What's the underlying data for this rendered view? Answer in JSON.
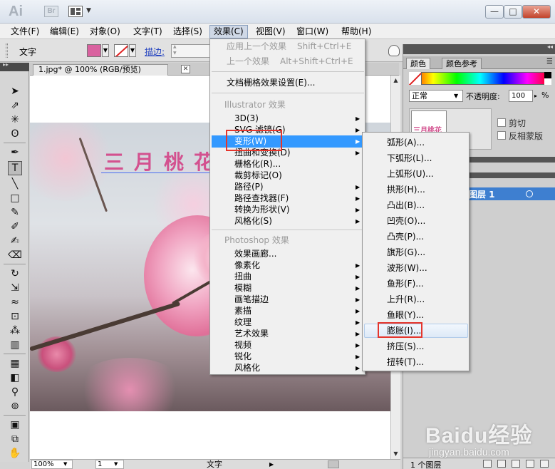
{
  "titlebar": {
    "app_logo": "Ai",
    "bridge_logo": "Br",
    "arrange_icon": "arrange-documents-icon",
    "minimize_label": "—",
    "maximize_label": "□",
    "close_label": "✕"
  },
  "menubar": {
    "items": [
      "文件(F)",
      "编辑(E)",
      "对象(O)",
      "文字(T)",
      "选择(S)",
      "效果(C)",
      "视图(V)",
      "窗口(W)",
      "帮助(H)"
    ],
    "open_index": 5
  },
  "controlbar": {
    "label": "文字",
    "fill_color": "#d9619f",
    "stroke_label": "描边:"
  },
  "document": {
    "tab_title": "1.jpg* @ 100% (RGB/预览)",
    "tab_close": "✕",
    "art_text": "三月桃花",
    "art_text_color": "#d3518f"
  },
  "statusbar": {
    "zoom": "100%",
    "page": "1",
    "tool_label": "文字"
  },
  "effect_menu": {
    "apply_last": {
      "label": "应用上一个效果",
      "shortcut": "Shift+Ctrl+E"
    },
    "last_effect": {
      "label": "上一个效果",
      "shortcut": "Alt+Shift+Ctrl+E"
    },
    "raster_settings": "文档栅格效果设置(E)...",
    "illustrator_header": "Illustrator 效果",
    "illustrator_items": [
      "3D(3)",
      "SVG 滤镜(G)",
      "变形(W)",
      "扭曲和变换(D)",
      "栅格化(R)...",
      "裁剪标记(O)",
      "路径(P)",
      "路径查找器(F)",
      "转换为形状(V)",
      "风格化(S)"
    ],
    "photoshop_header": "Photoshop 效果",
    "photoshop_items": [
      "效果画廊...",
      "像素化",
      "扭曲",
      "模糊",
      "画笔描边",
      "素描",
      "纹理",
      "艺术效果",
      "视频",
      "锐化",
      "风格化"
    ]
  },
  "warp_submenu": {
    "items": [
      "弧形(A)...",
      "下弧形(L)...",
      "上弧形(U)...",
      "拱形(H)...",
      "凸出(B)...",
      "凹壳(O)...",
      "凸壳(P)...",
      "旗形(G)...",
      "波形(W)...",
      "鱼形(F)...",
      "上升(R)...",
      "鱼眼(Y)...",
      "膨胀(I)...",
      "挤压(S)...",
      "扭转(T)..."
    ],
    "highlighted_index": 12
  },
  "right_panel": {
    "tabs": [
      "颜色",
      "颜色参考"
    ],
    "blend_mode": "正常",
    "opacity_label": "不透明度:",
    "opacity_value": "100",
    "opacity_unit": "%",
    "thumb_text": "三月桃花",
    "clip_label": "剪切",
    "invert_label": "反相蒙版",
    "layer_name": "图层 1",
    "layer_count": "1 个图层"
  },
  "watermark": {
    "main": "Baidu经验",
    "sub": "jingyan.baidu.com"
  }
}
